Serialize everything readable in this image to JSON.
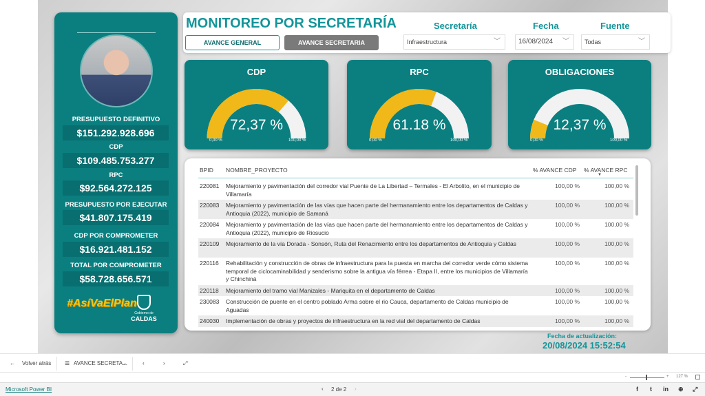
{
  "header": {
    "title": "MONITOREO POR SECRETARÍA",
    "tabs": [
      {
        "label": "AVANCE GENERAL",
        "active": false
      },
      {
        "label": "AVANCE SECRETARIA",
        "active": true
      }
    ]
  },
  "filters": {
    "secretaria": {
      "label": "Secretaría",
      "value": "Infraestructura"
    },
    "fecha": {
      "label": "Fecha",
      "value": "16/08/2024"
    },
    "fuente": {
      "label": "Fuente",
      "value": "Todas"
    }
  },
  "sidebar": {
    "kpis": [
      {
        "label": "PRESUPUESTO DEFINITIVO",
        "value": "$151.292.928.696"
      },
      {
        "label": "CDP",
        "value": "$109.485.753.277"
      },
      {
        "label": "RPC",
        "value": "$92.564.272.125"
      },
      {
        "label": "PRESUPUESTO POR EJECUTAR",
        "value": "$41.807.175.419"
      },
      {
        "label": "CDP POR COMPROMETER",
        "value": "$16.921.481.152"
      },
      {
        "label": "TOTAL POR COMPROMETER",
        "value": "$58.728.656.571"
      }
    ],
    "logo_left": "#AsíVaElPlan",
    "logo_right_small": "Gobierno de",
    "logo_right_big": "CALDAS"
  },
  "gauges": [
    {
      "title": "CDP",
      "value_text": "72,37 %",
      "percent": 72.37,
      "min": "0,00 %",
      "max": "100,00 %"
    },
    {
      "title": "RPC",
      "value_text": "61.18 %",
      "percent": 61.18,
      "min": "0,00 %",
      "max": "100,00 %"
    },
    {
      "title": "OBLIGACIONES",
      "value_text": "12,37 %",
      "percent": 12.37,
      "min": "0,00 %",
      "max": "100,00 %"
    }
  ],
  "colors": {
    "teal": "#0b7f80",
    "gauge_fill": "#f0b818",
    "gauge_track": "#f2f2f2"
  },
  "table": {
    "columns": [
      "BPID",
      "NOMBRE_PROYECTO",
      "% AVANCE CDP",
      "% AVANCE RPC"
    ],
    "sort_column": "% AVANCE RPC",
    "rows": [
      {
        "bpid": "220081",
        "nombre": "Mejoramiento y pavimentación del corredor vial Puente de La Libertad – Termales - El Arbolito, en el municipio de Villamaría",
        "cdp": "100,00 %",
        "rpc": "100,00 %"
      },
      {
        "bpid": "220083",
        "nombre": "Mejoramiento y pavimentación de las vías que hacen parte del hermanamiento entre los departamentos de Caldas y Antioquia (2022), municipio de Samaná",
        "cdp": "100,00 %",
        "rpc": "100,00 %"
      },
      {
        "bpid": "220084",
        "nombre": "Mejoramiento y pavimentación de las vías que hacen parte del hermanamiento entre los departamentos de Caldas y Antioquia (2022), municipio de Riosucio",
        "cdp": "100,00 %",
        "rpc": "100,00 %"
      },
      {
        "bpid": "220109",
        "nombre": "Mejoramiento de la vía Dorada - Sonsón, Ruta del Renacimiento entre los departamentos de Antioquia y Caldas",
        "cdp": "100,00 %",
        "rpc": "100,00 %"
      },
      {
        "bpid": "220116",
        "nombre": "Rehabilitación y construcción de obras de infraestructura para la puesta en marcha del corredor verde cómo sistema temporal de ciclocaminabilidad y senderismo sobre la antigua vía férrea - Etapa II, entre los municipios de Villamaría y Chinchiná",
        "cdp": "100,00 %",
        "rpc": "100,00 %"
      },
      {
        "bpid": "220118",
        "nombre": "Mejoramiento del tramo vial Manizales - Mariquita en el departamento de Caldas",
        "cdp": "100,00 %",
        "rpc": "100,00 %"
      },
      {
        "bpid": "230083",
        "nombre": "Construcción de puente en el centro poblado Arma sobre el rio Cauca, departamento de Caldas municipio de Aguadas",
        "cdp": "100,00 %",
        "rpc": "100,00 %"
      },
      {
        "bpid": "240030",
        "nombre": "Implementación de obras y proyectos de infraestructura en la red vial del departamento de Caldas",
        "cdp": "100,00 %",
        "rpc": "100,00 %"
      }
    ]
  },
  "update": {
    "label": "Fecha de actualización:",
    "value": "20/08/2024 15:52:54"
  },
  "navbar": {
    "back": "Volver atrás",
    "page_menu": "AVANCE SECRETA...",
    "zoom": "127 %"
  },
  "footer": {
    "brand": "Microsoft Power BI",
    "pager": "2 de 2"
  }
}
